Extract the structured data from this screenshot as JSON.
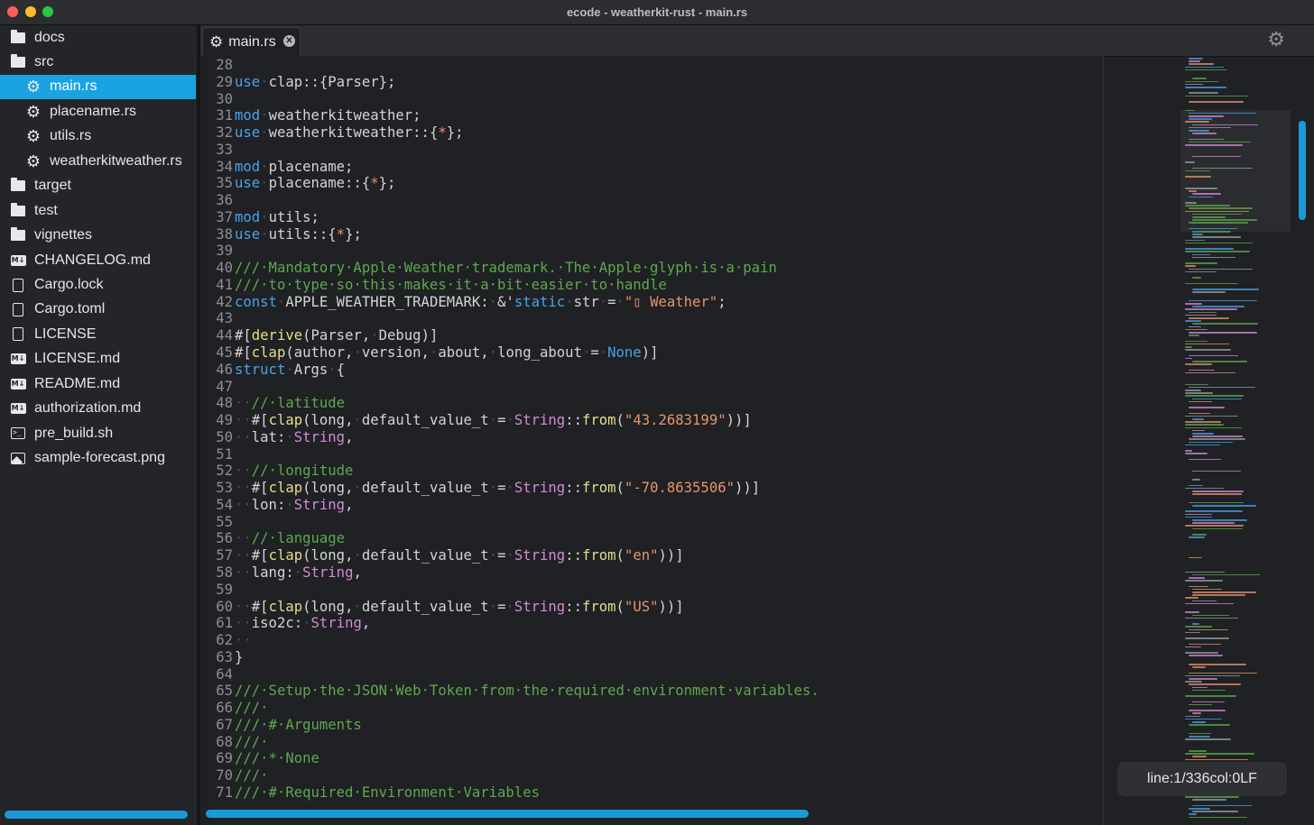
{
  "window": {
    "title": "ecode - weatherkit-rust - main.rs"
  },
  "sidebar": {
    "items": [
      {
        "label": "docs",
        "icon": "folder-icon",
        "depth": 0
      },
      {
        "label": "src",
        "icon": "folder-open-icon",
        "depth": 0
      },
      {
        "label": "main.rs",
        "icon": "rust-gear-icon",
        "depth": 1,
        "selected": true
      },
      {
        "label": "placename.rs",
        "icon": "rust-gear-icon",
        "depth": 1
      },
      {
        "label": "utils.rs",
        "icon": "rust-gear-icon",
        "depth": 1
      },
      {
        "label": "weatherkitweather.rs",
        "icon": "rust-gear-icon",
        "depth": 1
      },
      {
        "label": "target",
        "icon": "folder-icon",
        "depth": 0
      },
      {
        "label": "test",
        "icon": "folder-icon",
        "depth": 0
      },
      {
        "label": "vignettes",
        "icon": "folder-icon",
        "depth": 0
      },
      {
        "label": "CHANGELOG.md",
        "icon": "markdown-icon",
        "depth": 0
      },
      {
        "label": "Cargo.lock",
        "icon": "file-icon",
        "depth": 0
      },
      {
        "label": "Cargo.toml",
        "icon": "file-icon",
        "depth": 0
      },
      {
        "label": "LICENSE",
        "icon": "file-icon",
        "depth": 0
      },
      {
        "label": "LICENSE.md",
        "icon": "markdown-icon",
        "depth": 0
      },
      {
        "label": "README.md",
        "icon": "markdown-icon",
        "depth": 0
      },
      {
        "label": "authorization.md",
        "icon": "markdown-icon",
        "depth": 0
      },
      {
        "label": "pre_build.sh",
        "icon": "terminal-icon",
        "depth": 0
      },
      {
        "label": "sample-forecast.png",
        "icon": "image-icon",
        "depth": 0
      }
    ]
  },
  "tabs": [
    {
      "label": "main.rs",
      "icon": "rust-gear-icon",
      "active": true
    }
  ],
  "editor": {
    "active_line": "1",
    "lines": [
      {
        "n": "28",
        "tokens": []
      },
      {
        "n": "29",
        "tokens": [
          [
            "kw",
            "use"
          ],
          [
            "ws",
            "·"
          ],
          [
            "txt",
            "clap::{Parser};"
          ]
        ]
      },
      {
        "n": "30",
        "tokens": []
      },
      {
        "n": "31",
        "tokens": [
          [
            "kw",
            "mod"
          ],
          [
            "ws",
            "·"
          ],
          [
            "txt",
            "weatherkitweather;"
          ]
        ]
      },
      {
        "n": "32",
        "tokens": [
          [
            "kw",
            "use"
          ],
          [
            "ws",
            "·"
          ],
          [
            "txt",
            "weatherkitweather::{"
          ],
          [
            "st",
            "*"
          ],
          [
            "txt",
            "};"
          ]
        ]
      },
      {
        "n": "33",
        "tokens": []
      },
      {
        "n": "34",
        "tokens": [
          [
            "kw",
            "mod"
          ],
          [
            "ws",
            "·"
          ],
          [
            "txt",
            "placename;"
          ]
        ]
      },
      {
        "n": "35",
        "tokens": [
          [
            "kw",
            "use"
          ],
          [
            "ws",
            "·"
          ],
          [
            "txt",
            "placename::{"
          ],
          [
            "st",
            "*"
          ],
          [
            "txt",
            "};"
          ]
        ]
      },
      {
        "n": "36",
        "tokens": []
      },
      {
        "n": "37",
        "tokens": [
          [
            "kw",
            "mod"
          ],
          [
            "ws",
            "·"
          ],
          [
            "txt",
            "utils;"
          ]
        ]
      },
      {
        "n": "38",
        "tokens": [
          [
            "kw",
            "use"
          ],
          [
            "ws",
            "·"
          ],
          [
            "txt",
            "utils::{"
          ],
          [
            "st",
            "*"
          ],
          [
            "txt",
            "};"
          ]
        ]
      },
      {
        "n": "39",
        "tokens": []
      },
      {
        "n": "40",
        "tokens": [
          [
            "cm",
            "///·Mandatory·Apple·Weather·trademark.·The·Apple·glyph·is·a·pain"
          ]
        ]
      },
      {
        "n": "41",
        "tokens": [
          [
            "cm",
            "///·to·type·so·this·makes·it·a·bit·easier·to·handle"
          ]
        ]
      },
      {
        "n": "42",
        "tokens": [
          [
            "kw",
            "const"
          ],
          [
            "ws",
            "·"
          ],
          [
            "txt",
            "APPLE_WEATHER_TRADEMARK:"
          ],
          [
            "ws",
            "·"
          ],
          [
            "txt",
            "&'"
          ],
          [
            "kw",
            "static"
          ],
          [
            "ws",
            "·"
          ],
          [
            "txt",
            "str"
          ],
          [
            "ws",
            "·"
          ],
          [
            "txt",
            "="
          ],
          [
            "ws",
            "·"
          ],
          [
            "st",
            "\"▯ Weather\""
          ],
          [
            "txt",
            ";"
          ]
        ]
      },
      {
        "n": "43",
        "tokens": []
      },
      {
        "n": "44",
        "tokens": [
          [
            "txt",
            "#["
          ],
          [
            "fn",
            "derive"
          ],
          [
            "txt",
            "(Parser,"
          ],
          [
            "ws",
            "·"
          ],
          [
            "txt",
            "Debug)]"
          ]
        ]
      },
      {
        "n": "45",
        "tokens": [
          [
            "txt",
            "#["
          ],
          [
            "fn",
            "clap"
          ],
          [
            "txt",
            "(author,"
          ],
          [
            "ws",
            "·"
          ],
          [
            "txt",
            "version,"
          ],
          [
            "ws",
            "·"
          ],
          [
            "txt",
            "about,"
          ],
          [
            "ws",
            "·"
          ],
          [
            "txt",
            "long_about"
          ],
          [
            "ws",
            "·"
          ],
          [
            "txt",
            "="
          ],
          [
            "ws",
            "·"
          ],
          [
            "nn",
            "None"
          ],
          [
            "txt",
            ")]"
          ]
        ]
      },
      {
        "n": "46",
        "tokens": [
          [
            "kw",
            "struct"
          ],
          [
            "ws",
            "·"
          ],
          [
            "txt",
            "Args"
          ],
          [
            "ws",
            "·"
          ],
          [
            "txt",
            "{"
          ]
        ]
      },
      {
        "n": "47",
        "tokens": []
      },
      {
        "n": "48",
        "tokens": [
          [
            "ws",
            "··"
          ],
          [
            "cm",
            "//·latitude"
          ]
        ]
      },
      {
        "n": "49",
        "tokens": [
          [
            "ws",
            "··"
          ],
          [
            "txt",
            "#["
          ],
          [
            "fn",
            "clap"
          ],
          [
            "txt",
            "(long,"
          ],
          [
            "ws",
            "·"
          ],
          [
            "txt",
            "default_value_t"
          ],
          [
            "ws",
            "·"
          ],
          [
            "txt",
            "="
          ],
          [
            "ws",
            "·"
          ],
          [
            "ty",
            "String"
          ],
          [
            "txt",
            "::"
          ],
          [
            "fn",
            "from"
          ],
          [
            "txt",
            "("
          ],
          [
            "st",
            "\"43.2683199\""
          ],
          [
            "txt",
            "))]"
          ]
        ]
      },
      {
        "n": "50",
        "tokens": [
          [
            "ws",
            "··"
          ],
          [
            "txt",
            "lat:"
          ],
          [
            "ws",
            "·"
          ],
          [
            "ty",
            "String"
          ],
          [
            "txt",
            ","
          ]
        ]
      },
      {
        "n": "51",
        "tokens": []
      },
      {
        "n": "52",
        "tokens": [
          [
            "ws",
            "··"
          ],
          [
            "cm",
            "//·longitude"
          ]
        ]
      },
      {
        "n": "53",
        "tokens": [
          [
            "ws",
            "··"
          ],
          [
            "txt",
            "#["
          ],
          [
            "fn",
            "clap"
          ],
          [
            "txt",
            "(long,"
          ],
          [
            "ws",
            "·"
          ],
          [
            "txt",
            "default_value_t"
          ],
          [
            "ws",
            "·"
          ],
          [
            "txt",
            "="
          ],
          [
            "ws",
            "·"
          ],
          [
            "ty",
            "String"
          ],
          [
            "txt",
            "::"
          ],
          [
            "fn",
            "from"
          ],
          [
            "txt",
            "("
          ],
          [
            "st",
            "\"-70.8635506\""
          ],
          [
            "txt",
            "))]"
          ]
        ]
      },
      {
        "n": "54",
        "tokens": [
          [
            "ws",
            "··"
          ],
          [
            "txt",
            "lon:"
          ],
          [
            "ws",
            "·"
          ],
          [
            "ty",
            "String"
          ],
          [
            "txt",
            ","
          ]
        ]
      },
      {
        "n": "55",
        "tokens": []
      },
      {
        "n": "56",
        "tokens": [
          [
            "ws",
            "··"
          ],
          [
            "cm",
            "//·language"
          ]
        ]
      },
      {
        "n": "57",
        "tokens": [
          [
            "ws",
            "··"
          ],
          [
            "txt",
            "#["
          ],
          [
            "fn",
            "clap"
          ],
          [
            "txt",
            "(long,"
          ],
          [
            "ws",
            "·"
          ],
          [
            "txt",
            "default_value_t"
          ],
          [
            "ws",
            "·"
          ],
          [
            "txt",
            "="
          ],
          [
            "ws",
            "·"
          ],
          [
            "ty",
            "String"
          ],
          [
            "txt",
            "::"
          ],
          [
            "fn",
            "from"
          ],
          [
            "txt",
            "("
          ],
          [
            "st",
            "\"en\""
          ],
          [
            "txt",
            "))]"
          ]
        ]
      },
      {
        "n": "58",
        "tokens": [
          [
            "ws",
            "··"
          ],
          [
            "txt",
            "lang:"
          ],
          [
            "ws",
            "·"
          ],
          [
            "ty",
            "String"
          ],
          [
            "txt",
            ","
          ]
        ]
      },
      {
        "n": "59",
        "tokens": []
      },
      {
        "n": "60",
        "tokens": [
          [
            "ws",
            "··"
          ],
          [
            "txt",
            "#["
          ],
          [
            "fn",
            "clap"
          ],
          [
            "txt",
            "(long,"
          ],
          [
            "ws",
            "·"
          ],
          [
            "txt",
            "default_value_t"
          ],
          [
            "ws",
            "·"
          ],
          [
            "txt",
            "="
          ],
          [
            "ws",
            "·"
          ],
          [
            "ty",
            "String"
          ],
          [
            "txt",
            "::"
          ],
          [
            "fn",
            "from"
          ],
          [
            "txt",
            "("
          ],
          [
            "st",
            "\"US\""
          ],
          [
            "txt",
            "))]"
          ]
        ]
      },
      {
        "n": "61",
        "tokens": [
          [
            "ws",
            "··"
          ],
          [
            "txt",
            "iso2c:"
          ],
          [
            "ws",
            "·"
          ],
          [
            "ty",
            "String"
          ],
          [
            "txt",
            ","
          ]
        ]
      },
      {
        "n": "62",
        "tokens": [
          [
            "ws",
            "··"
          ]
        ]
      },
      {
        "n": "63",
        "tokens": [
          [
            "txt",
            "}"
          ]
        ]
      },
      {
        "n": "64",
        "tokens": []
      },
      {
        "n": "65",
        "tokens": [
          [
            "cm",
            "///·Setup·the·JSON·Web·Token·from·the·required·environment·variables."
          ]
        ]
      },
      {
        "n": "66",
        "tokens": [
          [
            "cm",
            "///·"
          ]
        ]
      },
      {
        "n": "67",
        "tokens": [
          [
            "cm",
            "///·#·Arguments"
          ]
        ]
      },
      {
        "n": "68",
        "tokens": [
          [
            "cm",
            "///·"
          ]
        ]
      },
      {
        "n": "69",
        "tokens": [
          [
            "cm",
            "///·*·None"
          ]
        ]
      },
      {
        "n": "70",
        "tokens": [
          [
            "cm",
            "///·"
          ]
        ]
      },
      {
        "n": "71",
        "tokens": [
          [
            "cm",
            "///·#·Required·Environment·Variables"
          ]
        ]
      }
    ]
  },
  "status": {
    "line_label": "line:",
    "line_value": "1",
    "line_sep": "/",
    "line_total": "336",
    "col_label": "col:",
    "col_value": "0",
    "eol": "LF"
  },
  "colors": {
    "accent": "#1aa3e0",
    "keyword": "#4aa3e8",
    "comment": "#5ea84e",
    "string": "#e6946b",
    "type": "#d58ad6",
    "function": "#e7dd8a"
  }
}
